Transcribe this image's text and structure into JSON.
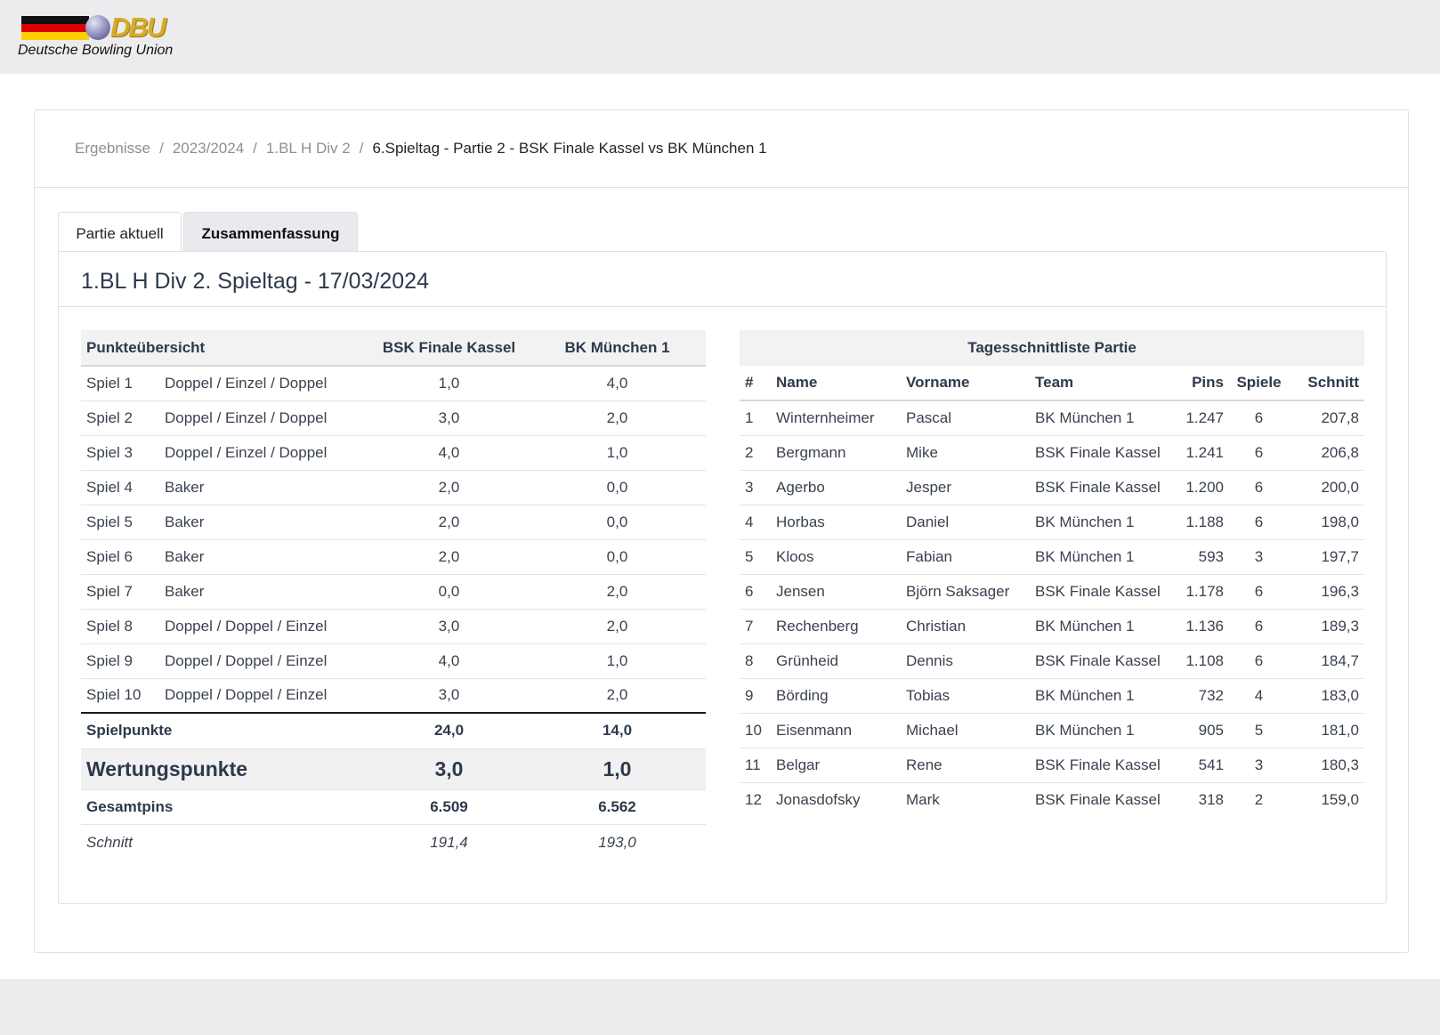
{
  "logo": {
    "mark": "DBU",
    "subtitle": "Deutsche Bowling Union"
  },
  "breadcrumb": {
    "items": [
      "Ergebnisse",
      "2023/2024",
      "1.BL H Div 2"
    ],
    "current": "6.Spieltag - Partie 2 - BSK Finale Kassel vs BK München 1"
  },
  "tabs": [
    {
      "label": "Partie aktuell",
      "active": false
    },
    {
      "label": "Zusammenfassung",
      "active": true
    }
  ],
  "panel": {
    "title": "1.BL H Div 2. Spieltag - 17/03/2024"
  },
  "points": {
    "header": {
      "label": "Punkteübersicht",
      "team1": "BSK Finale Kassel",
      "team2": "BK München 1"
    },
    "games": [
      {
        "game": "Spiel 1",
        "mode": "Doppel / Einzel / Doppel",
        "t1": "1,0",
        "t2": "4,0"
      },
      {
        "game": "Spiel 2",
        "mode": "Doppel / Einzel / Doppel",
        "t1": "3,0",
        "t2": "2,0"
      },
      {
        "game": "Spiel 3",
        "mode": "Doppel / Einzel / Doppel",
        "t1": "4,0",
        "t2": "1,0"
      },
      {
        "game": "Spiel 4",
        "mode": "Baker",
        "t1": "2,0",
        "t2": "0,0"
      },
      {
        "game": "Spiel 5",
        "mode": "Baker",
        "t1": "2,0",
        "t2": "0,0"
      },
      {
        "game": "Spiel 6",
        "mode": "Baker",
        "t1": "2,0",
        "t2": "0,0"
      },
      {
        "game": "Spiel 7",
        "mode": "Baker",
        "t1": "0,0",
        "t2": "2,0"
      },
      {
        "game": "Spiel 8",
        "mode": "Doppel / Doppel / Einzel",
        "t1": "3,0",
        "t2": "2,0"
      },
      {
        "game": "Spiel 9",
        "mode": "Doppel / Doppel / Einzel",
        "t1": "4,0",
        "t2": "1,0"
      },
      {
        "game": "Spiel 10",
        "mode": "Doppel / Doppel / Einzel",
        "t1": "3,0",
        "t2": "2,0"
      }
    ],
    "spielpunkte": {
      "label": "Spielpunkte",
      "t1": "24,0",
      "t2": "14,0"
    },
    "wertungspunkte": {
      "label": "Wertungspunkte",
      "t1": "3,0",
      "t2": "1,0"
    },
    "gesamtpins": {
      "label": "Gesamtpins",
      "t1": "6.509",
      "t2": "6.562"
    },
    "schnitt": {
      "label": "Schnitt",
      "t1": "191,4",
      "t2": "193,0"
    }
  },
  "ranking": {
    "title": "Tagesschnittliste Partie",
    "columns": {
      "rank": "#",
      "name": "Name",
      "vorname": "Vorname",
      "team": "Team",
      "pins": "Pins",
      "spiele": "Spiele",
      "schnitt": "Schnitt"
    },
    "rows": [
      {
        "rank": "1",
        "name": "Winternheimer",
        "vorname": "Pascal",
        "team": "BK München 1",
        "pins": "1.247",
        "spiele": "6",
        "schnitt": "207,8"
      },
      {
        "rank": "2",
        "name": "Bergmann",
        "vorname": "Mike",
        "team": "BSK Finale Kassel",
        "pins": "1.241",
        "spiele": "6",
        "schnitt": "206,8"
      },
      {
        "rank": "3",
        "name": "Agerbo",
        "vorname": "Jesper",
        "team": "BSK Finale Kassel",
        "pins": "1.200",
        "spiele": "6",
        "schnitt": "200,0"
      },
      {
        "rank": "4",
        "name": "Horbas",
        "vorname": "Daniel",
        "team": "BK München 1",
        "pins": "1.188",
        "spiele": "6",
        "schnitt": "198,0"
      },
      {
        "rank": "5",
        "name": "Kloos",
        "vorname": "Fabian",
        "team": "BK München 1",
        "pins": "593",
        "spiele": "3",
        "schnitt": "197,7"
      },
      {
        "rank": "6",
        "name": "Jensen",
        "vorname": "Björn Saksager",
        "team": "BSK Finale Kassel",
        "pins": "1.178",
        "spiele": "6",
        "schnitt": "196,3"
      },
      {
        "rank": "7",
        "name": "Rechenberg",
        "vorname": "Christian",
        "team": "BK München 1",
        "pins": "1.136",
        "spiele": "6",
        "schnitt": "189,3"
      },
      {
        "rank": "8",
        "name": "Grünheid",
        "vorname": "Dennis",
        "team": "BSK Finale Kassel",
        "pins": "1.108",
        "spiele": "6",
        "schnitt": "184,7"
      },
      {
        "rank": "9",
        "name": "Börding",
        "vorname": "Tobias",
        "team": "BK München 1",
        "pins": "732",
        "spiele": "4",
        "schnitt": "183,0"
      },
      {
        "rank": "10",
        "name": "Eisenmann",
        "vorname": "Michael",
        "team": "BK München 1",
        "pins": "905",
        "spiele": "5",
        "schnitt": "181,0"
      },
      {
        "rank": "11",
        "name": "Belgar",
        "vorname": "Rene",
        "team": "BSK Finale Kassel",
        "pins": "541",
        "spiele": "3",
        "schnitt": "180,3"
      },
      {
        "rank": "12",
        "name": "Jonasdofsky",
        "vorname": "Mark",
        "team": "BSK Finale Kassel",
        "pins": "318",
        "spiele": "2",
        "schnitt": "159,0"
      }
    ]
  }
}
